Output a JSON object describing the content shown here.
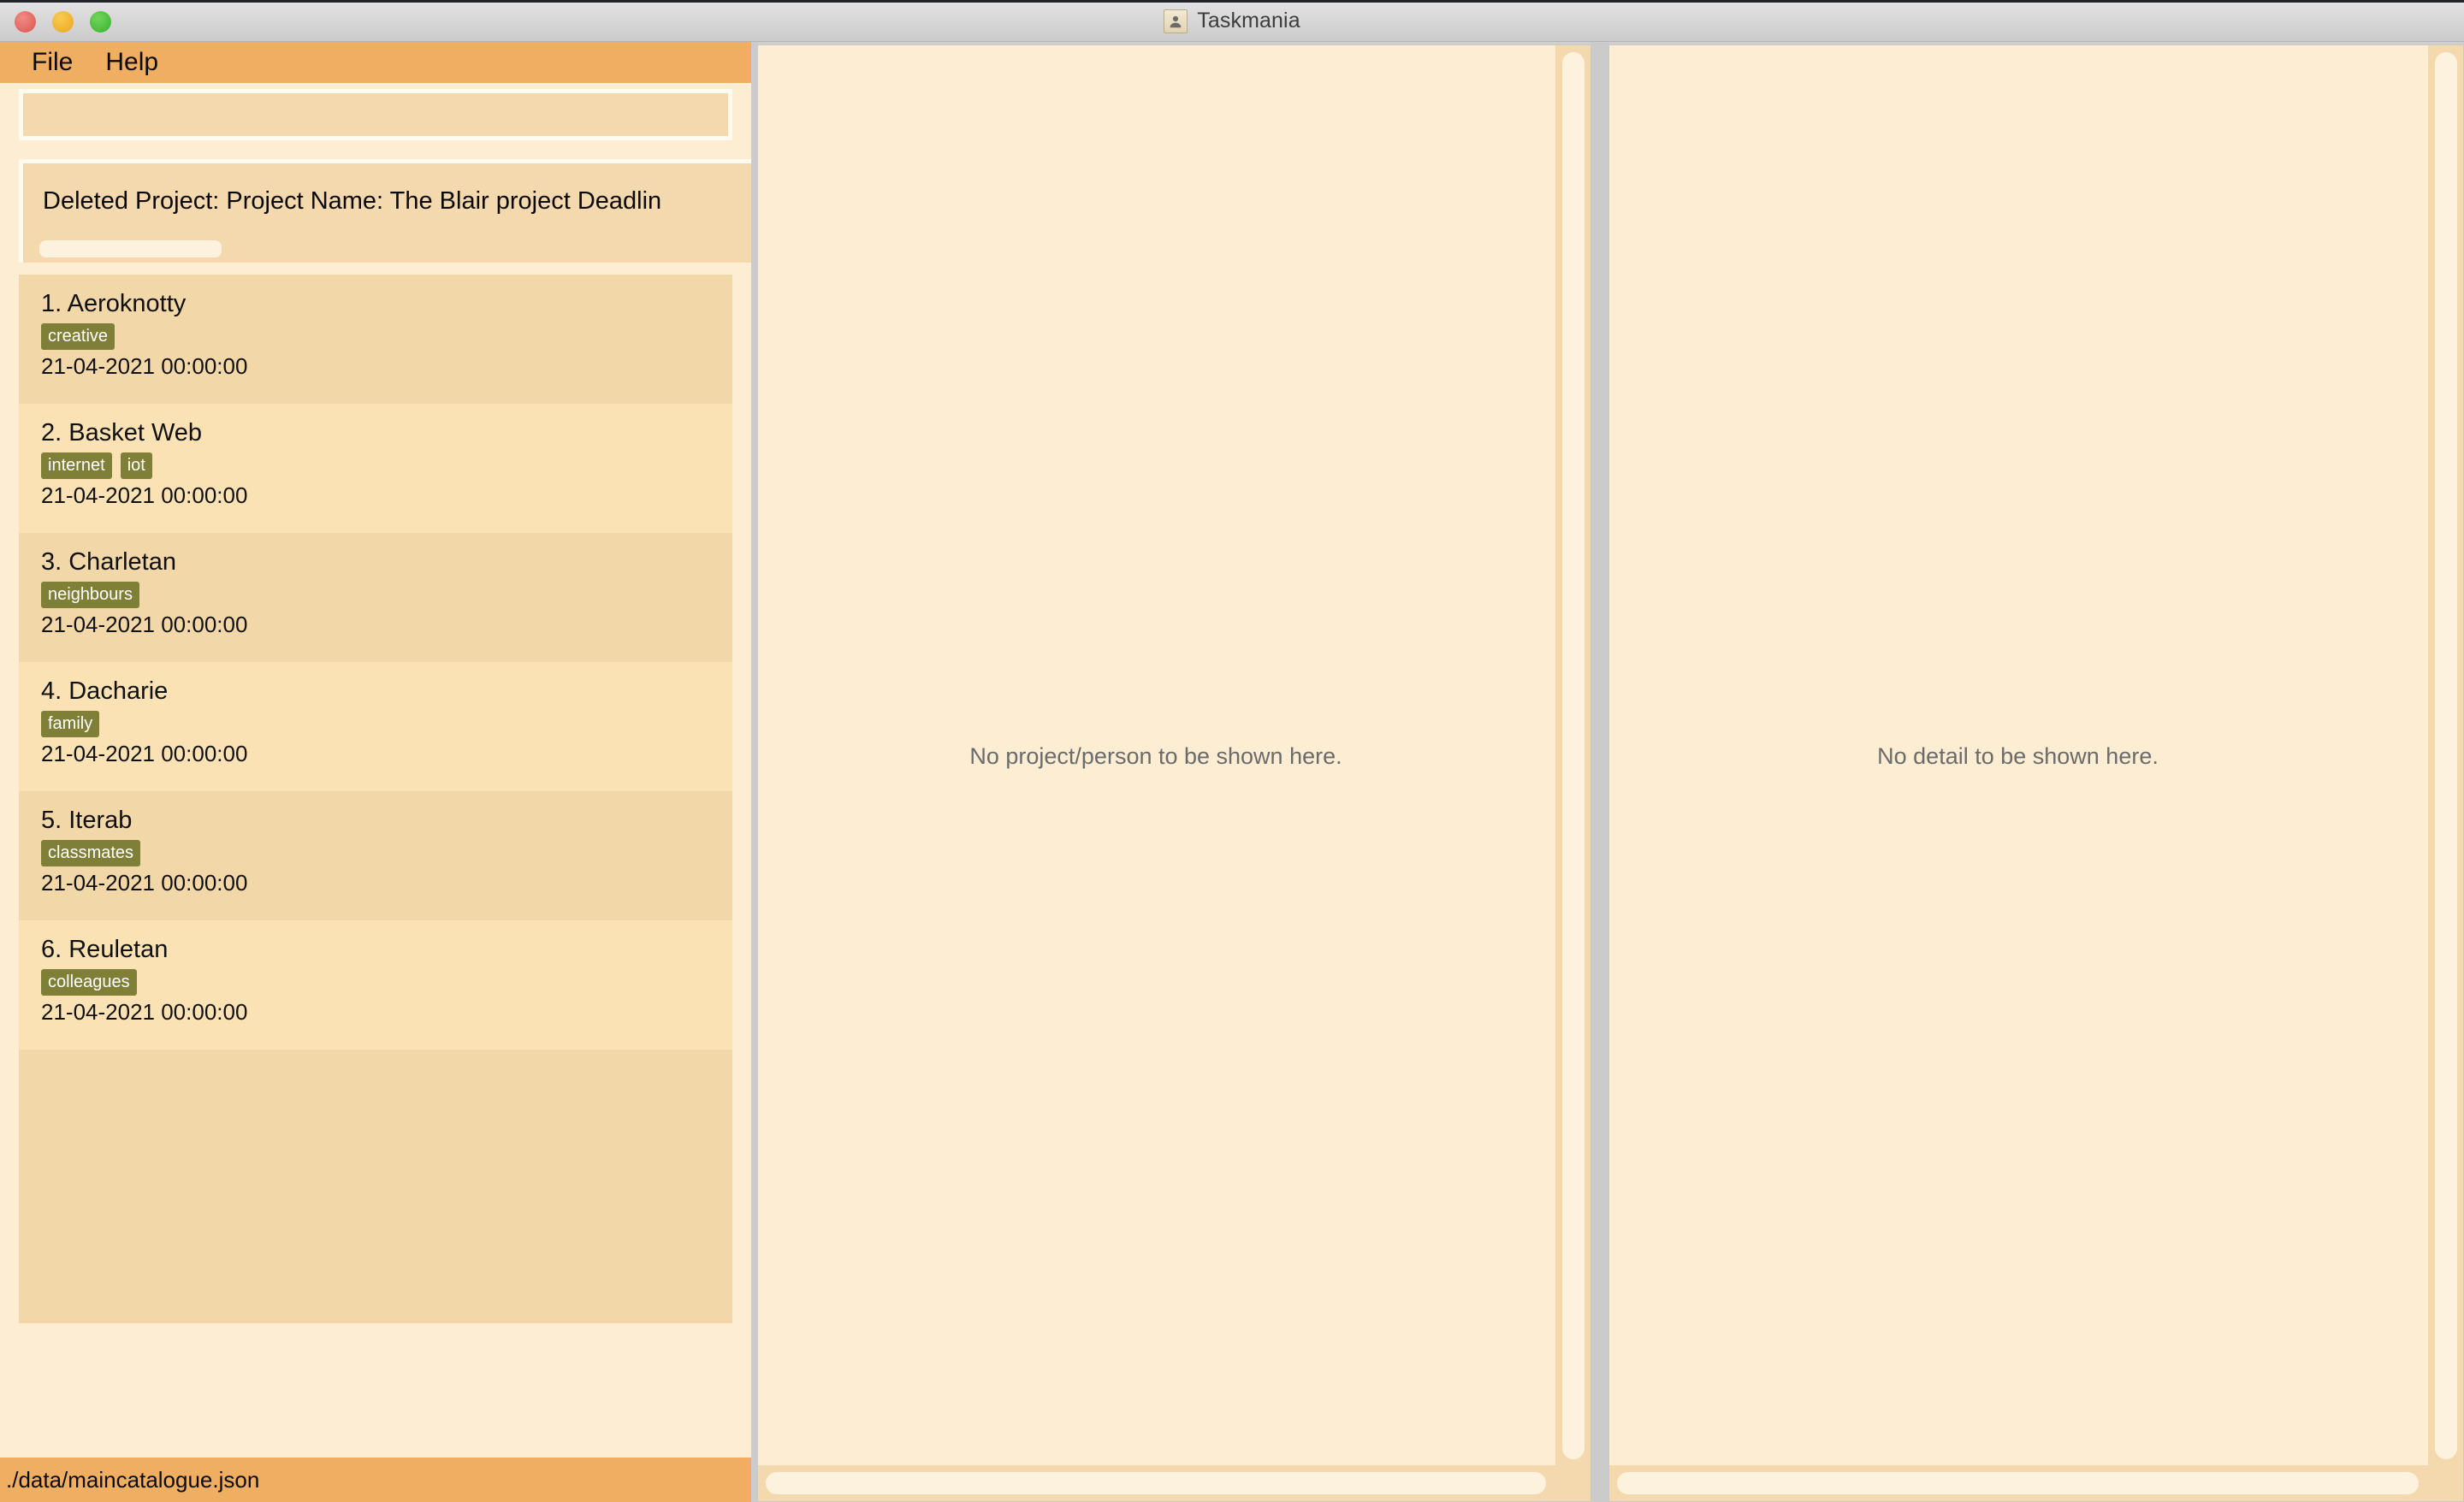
{
  "window": {
    "title": "Taskmania",
    "icon": "contact-card-icon",
    "controls": [
      "close",
      "minimize",
      "maximize"
    ]
  },
  "menubar": {
    "items": [
      {
        "label": "File"
      },
      {
        "label": "Help"
      }
    ]
  },
  "left_panel": {
    "search": {
      "value": "",
      "placeholder": ""
    },
    "deleted_project": {
      "text": "Deleted Project:  Project Name: The Blair project Deadlin"
    },
    "list": [
      {
        "index": "1.",
        "name": "Aeroknotty",
        "tags": [
          "creative"
        ],
        "date": "21-04-2021 00:00:00"
      },
      {
        "index": "2.",
        "name": "Basket Web",
        "tags": [
          "internet",
          "iot"
        ],
        "date": "21-04-2021 00:00:00"
      },
      {
        "index": "3.",
        "name": "Charletan",
        "tags": [
          "neighbours"
        ],
        "date": "21-04-2021 00:00:00"
      },
      {
        "index": "4.",
        "name": "Dacharie",
        "tags": [
          "family"
        ],
        "date": "21-04-2021 00:00:00"
      },
      {
        "index": "5.",
        "name": "Iterab",
        "tags": [
          "classmates"
        ],
        "date": "21-04-2021 00:00:00"
      },
      {
        "index": "6.",
        "name": "Reuletan",
        "tags": [
          "colleagues"
        ],
        "date": "21-04-2021 00:00:00"
      }
    ]
  },
  "center_panel": {
    "placeholder": "No project/person to be shown here."
  },
  "right_panel": {
    "placeholder": "No detail to be shown here."
  },
  "statusbar": {
    "path": "./data/maincatalogue.json"
  },
  "colors": {
    "accent_orange": "#f0ae62",
    "panel_bg": "#fcedd3",
    "row_odd": "#f2d7a8",
    "row_even": "#fae2b5",
    "tag_bg": "#7f7f37",
    "tag_text": "#ffffff",
    "input_bg": "#f5d9ae",
    "placeholder_text": "#6b6b6b",
    "titlebar": "#d6d6d6"
  }
}
